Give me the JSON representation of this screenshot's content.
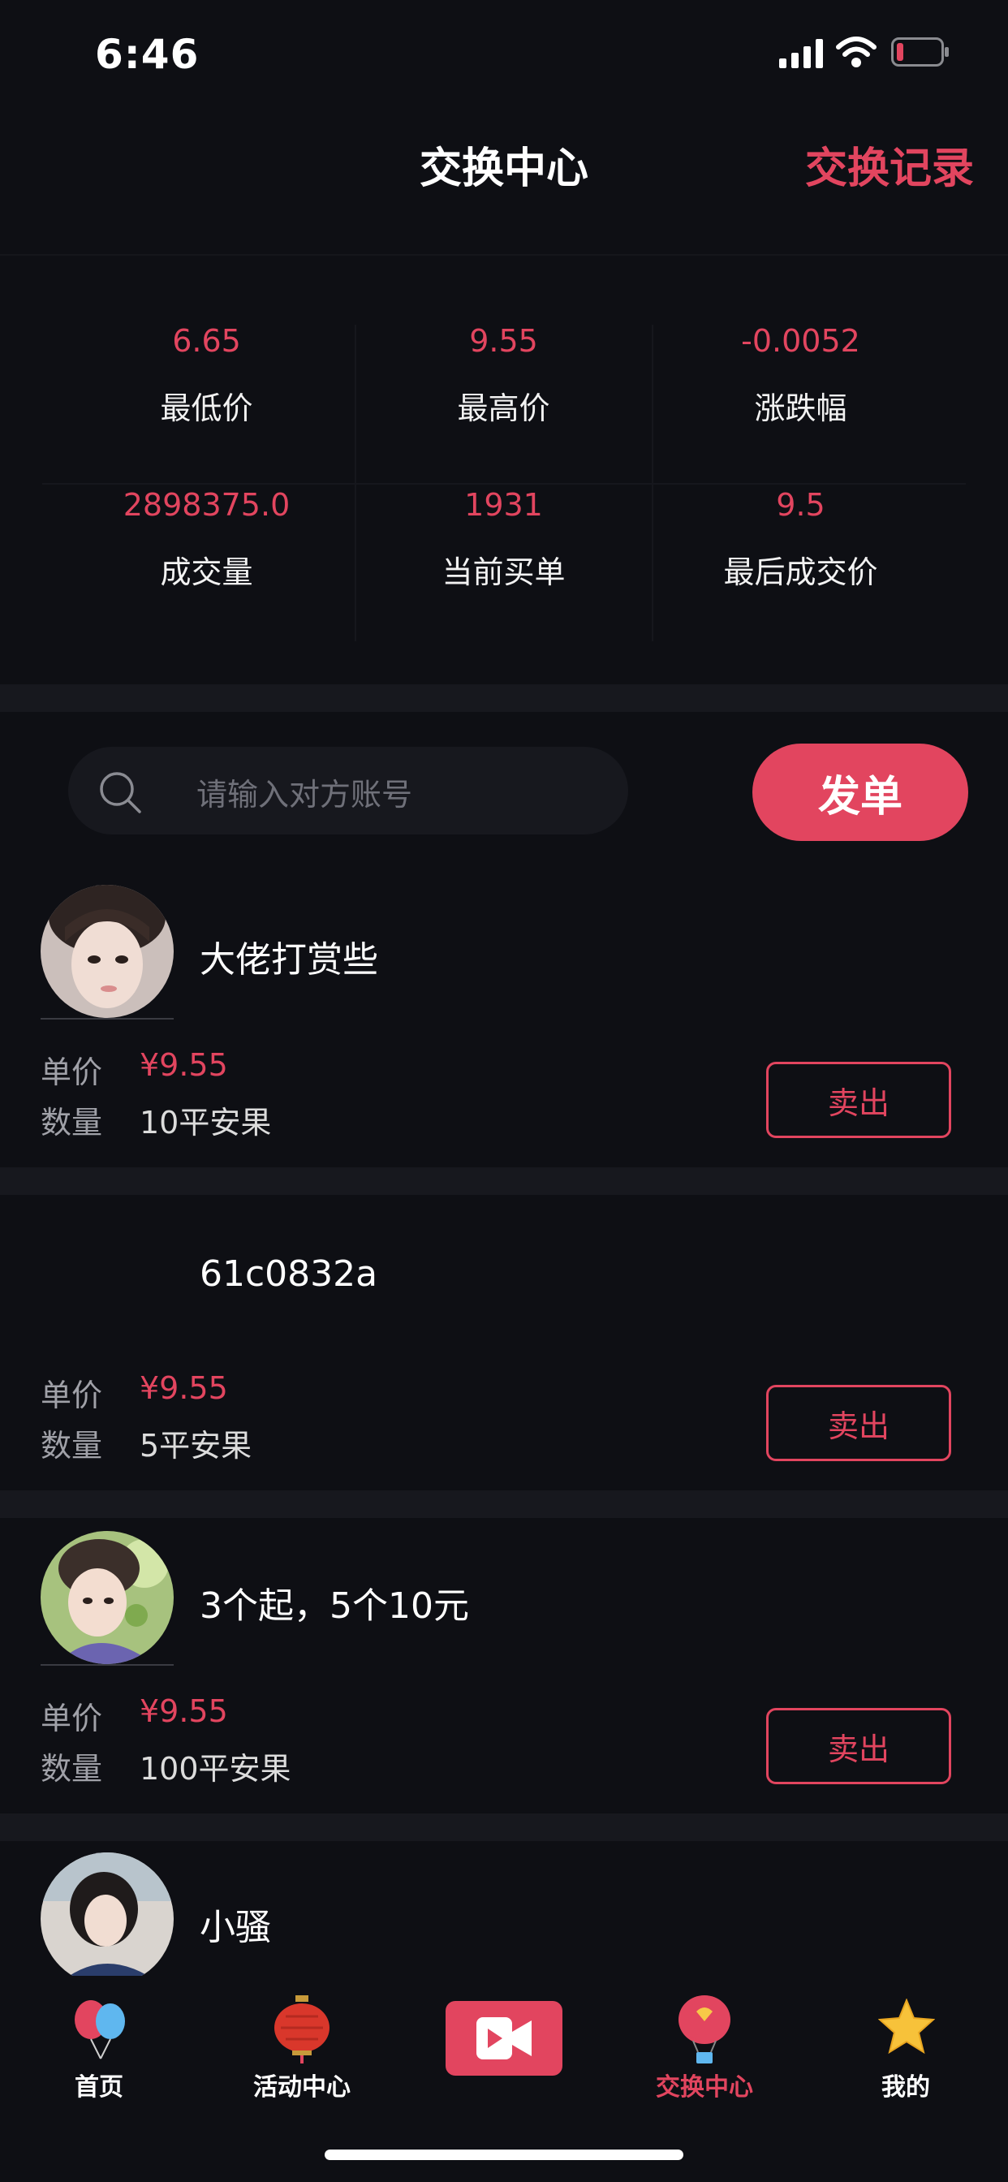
{
  "status_bar": {
    "time": "6:46"
  },
  "header": {
    "title": "交换中心",
    "right_link": "交换记录"
  },
  "stats": [
    {
      "value": "6.65",
      "label": "最低价"
    },
    {
      "value": "9.55",
      "label": "最高价"
    },
    {
      "value": "-0.0052",
      "label": "涨跌幅"
    },
    {
      "value": "2898375.0",
      "label": "成交量"
    },
    {
      "value": "1931",
      "label": "当前买单"
    },
    {
      "value": "9.5",
      "label": "最后成交价"
    }
  ],
  "search": {
    "placeholder": "请输入对方账号",
    "icon": "search-icon"
  },
  "post_button": "发单",
  "listing_labels": {
    "price": "单价",
    "quantity": "数量",
    "action": "卖出"
  },
  "listings": [
    {
      "name": "大佬打赏些",
      "price": "¥9.55",
      "quantity": "10平安果"
    },
    {
      "name": "61c0832a",
      "price": "¥9.55",
      "quantity": "5平安果"
    },
    {
      "name": "3个起，5个10元",
      "price": "¥9.55",
      "quantity": "100平安果"
    },
    {
      "name": "小骚"
    }
  ],
  "tabbar": [
    {
      "label": "首页",
      "icon": "balloons-icon"
    },
    {
      "label": "活动中心",
      "icon": "lantern-icon"
    },
    {
      "label": "",
      "icon": "video-camera-icon"
    },
    {
      "label": "交换中心",
      "icon": "hot-air-balloon-icon",
      "active": true
    },
    {
      "label": "我的",
      "icon": "star-icon"
    }
  ],
  "colors": {
    "accent": "#e2455f",
    "background": "#0e0f14",
    "panel": "#17181e"
  }
}
